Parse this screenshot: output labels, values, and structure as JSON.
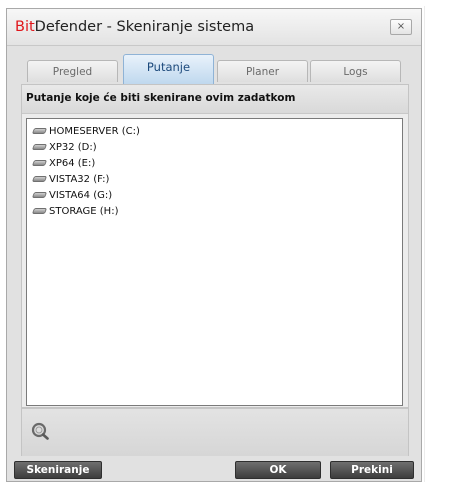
{
  "window": {
    "title_brand_colored": "Bit",
    "title_brand_rest": "Defender",
    "title_rest": " - Skeniranje sistema",
    "close_label": "×"
  },
  "tabs": [
    {
      "label": "Pregled",
      "active": false
    },
    {
      "label": "Putanje",
      "active": true
    },
    {
      "label": "Planer",
      "active": false
    },
    {
      "label": "Logs",
      "active": false
    }
  ],
  "panel": {
    "header": "Putanje koje će biti skenirane ovim zadatkom",
    "drives": [
      {
        "label": "HOMESERVER (C:)",
        "icon": "drive-icon"
      },
      {
        "label": "XP32 (D:)",
        "icon": "drive-icon"
      },
      {
        "label": "XP64 (E:)",
        "icon": "drive-icon"
      },
      {
        "label": "VISTA32 (F:)",
        "icon": "drive-icon"
      },
      {
        "label": "VISTA64 (G:)",
        "icon": "drive-icon"
      },
      {
        "label": "STORAGE (H:)",
        "icon": "drive-icon"
      }
    ]
  },
  "toolbar": {
    "icon": "search-icon"
  },
  "buttons": {
    "scan": "Skeniranje",
    "ok": "OK",
    "cancel": "Prekini"
  },
  "colors": {
    "brand_red": "#e0161b",
    "tab_active_text": "#1d4a7c",
    "button_bg": "#4a4a4a"
  }
}
